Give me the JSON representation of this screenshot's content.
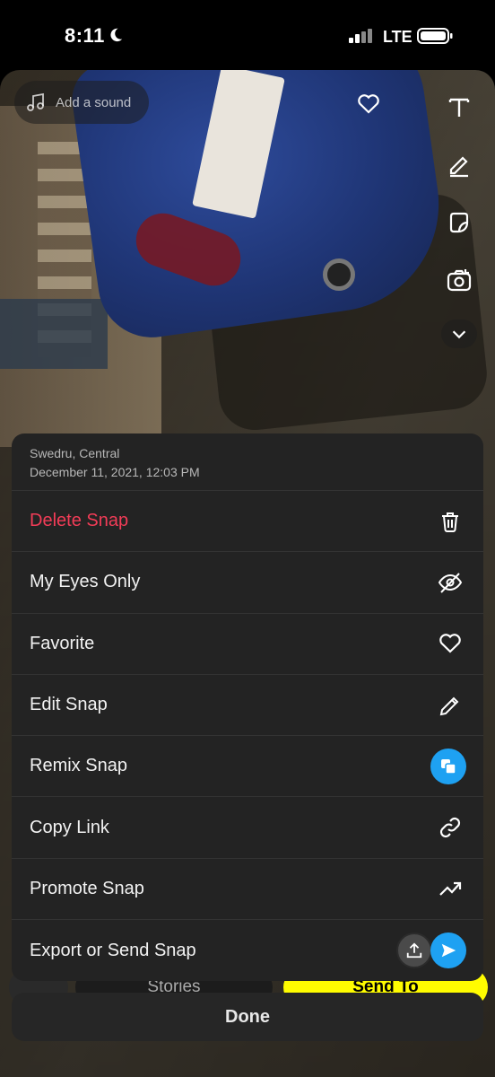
{
  "status_bar": {
    "time": "8:11",
    "network": "LTE"
  },
  "preview": {
    "add_sound_label": "Add a sound",
    "tools": [
      "text-icon",
      "pencil-icon",
      "sticker-icon",
      "camera-flip-icon",
      "chevron-down-icon"
    ]
  },
  "bottom_bar": {
    "stories_label": "Stories",
    "send_to_label": "Send To"
  },
  "sheet": {
    "location": "Swedru, Central",
    "date": "December 11, 2021, 12:03 PM",
    "items": [
      {
        "label": "Delete Snap",
        "icon": "trash-icon",
        "danger": true
      },
      {
        "label": "My Eyes Only",
        "icon": "eye-slash-icon"
      },
      {
        "label": "Favorite",
        "icon": "heart-icon"
      },
      {
        "label": "Edit Snap",
        "icon": "pencil-icon"
      },
      {
        "label": "Remix Snap",
        "icon": "remix-icon"
      },
      {
        "label": "Copy Link",
        "icon": "link-icon"
      },
      {
        "label": "Promote Snap",
        "icon": "trending-up-icon"
      },
      {
        "label": "Export or Send Snap",
        "icon": "upload-icon"
      }
    ]
  },
  "done_label": "Done",
  "colors": {
    "danger": "#f23c57",
    "accent": "#1ea1f2",
    "snap_yellow": "#fffc00",
    "sheet_bg": "#232323"
  }
}
